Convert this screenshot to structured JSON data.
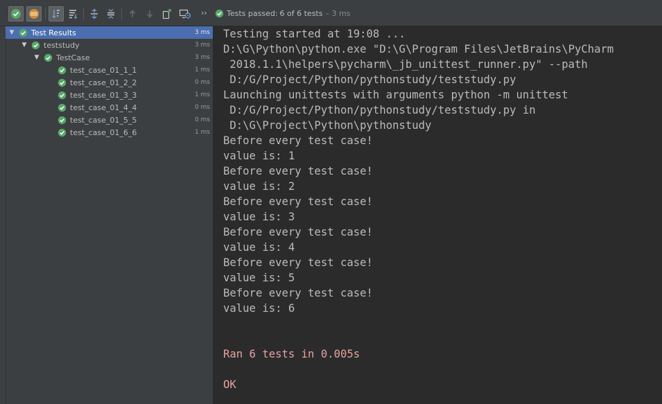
{
  "toolbar": {
    "status_label": "Tests passed:",
    "status_count": "6 of 6 tests",
    "status_time": "– 3 ms",
    "more": "››"
  },
  "tree": {
    "items": [
      {
        "label": "Test Results",
        "time": "3 ms"
      },
      {
        "label": "teststudy",
        "time": "3 ms"
      },
      {
        "label": "TestCase",
        "time": "3 ms"
      },
      {
        "label": "test_case_01_1_1",
        "time": "1 ms"
      },
      {
        "label": "test_case_01_2_2",
        "time": "0 ms"
      },
      {
        "label": "test_case_01_3_3",
        "time": "1 ms"
      },
      {
        "label": "test_case_01_4_4",
        "time": "0 ms"
      },
      {
        "label": "test_case_01_5_5",
        "time": "0 ms"
      },
      {
        "label": "test_case_01_6_6",
        "time": "1 ms"
      }
    ]
  },
  "console": {
    "lines": [
      "Testing started at 19:08 ...",
      "D:\\G\\Python\\python.exe \"D:\\G\\Program Files\\JetBrains\\PyCharm",
      " 2018.1.1\\helpers\\pycharm\\_jb_unittest_runner.py\" --path",
      " D:/G/Project/Python/pythonstudy/teststudy.py",
      "Launching unittests with arguments python -m unittest",
      " D:/G/Project/Python/pythonstudy/teststudy.py in",
      " D:\\G\\Project\\Python\\pythonstudy",
      "Before every test case!",
      "value is: 1",
      "Before every test case!",
      "value is: 2",
      "Before every test case!",
      "value is: 3",
      "Before every test case!",
      "value is: 4",
      "Before every test case!",
      "value is: 5",
      "Before every test case!",
      "value is: 6",
      "",
      "",
      "Ran 6 tests in 0.005s",
      "",
      "OK"
    ]
  },
  "colors": {
    "pass_green": "#59a869",
    "selection": "#4b6eaf",
    "console_error": "#e8a1a1"
  }
}
